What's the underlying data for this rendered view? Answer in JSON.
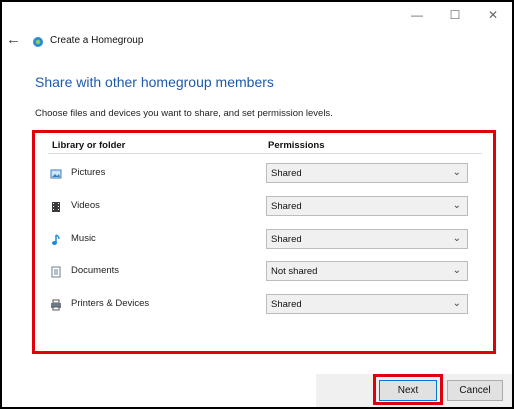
{
  "window": {
    "title": "Create a Homegroup",
    "controls": {
      "minimize": "—",
      "maximize": "☐",
      "close": "✕"
    }
  },
  "nav": {
    "back_glyph": "←"
  },
  "page": {
    "heading": "Share with other homegroup members",
    "subtext": "Choose files and devices you want to share, and set permission levels."
  },
  "table": {
    "headers": {
      "library": "Library or folder",
      "permissions": "Permissions"
    },
    "rows": [
      {
        "label": "Pictures",
        "icon": "pictures-icon",
        "permission": "Shared"
      },
      {
        "label": "Videos",
        "icon": "videos-icon",
        "permission": "Shared"
      },
      {
        "label": "Music",
        "icon": "music-icon",
        "permission": "Shared"
      },
      {
        "label": "Documents",
        "icon": "documents-icon",
        "permission": "Not shared"
      },
      {
        "label": "Printers & Devices",
        "icon": "printer-icon",
        "permission": "Shared"
      }
    ]
  },
  "buttons": {
    "next": "Next",
    "cancel": "Cancel"
  },
  "colors": {
    "accent_heading": "#1e5aa8",
    "highlight": "#e0000b"
  }
}
